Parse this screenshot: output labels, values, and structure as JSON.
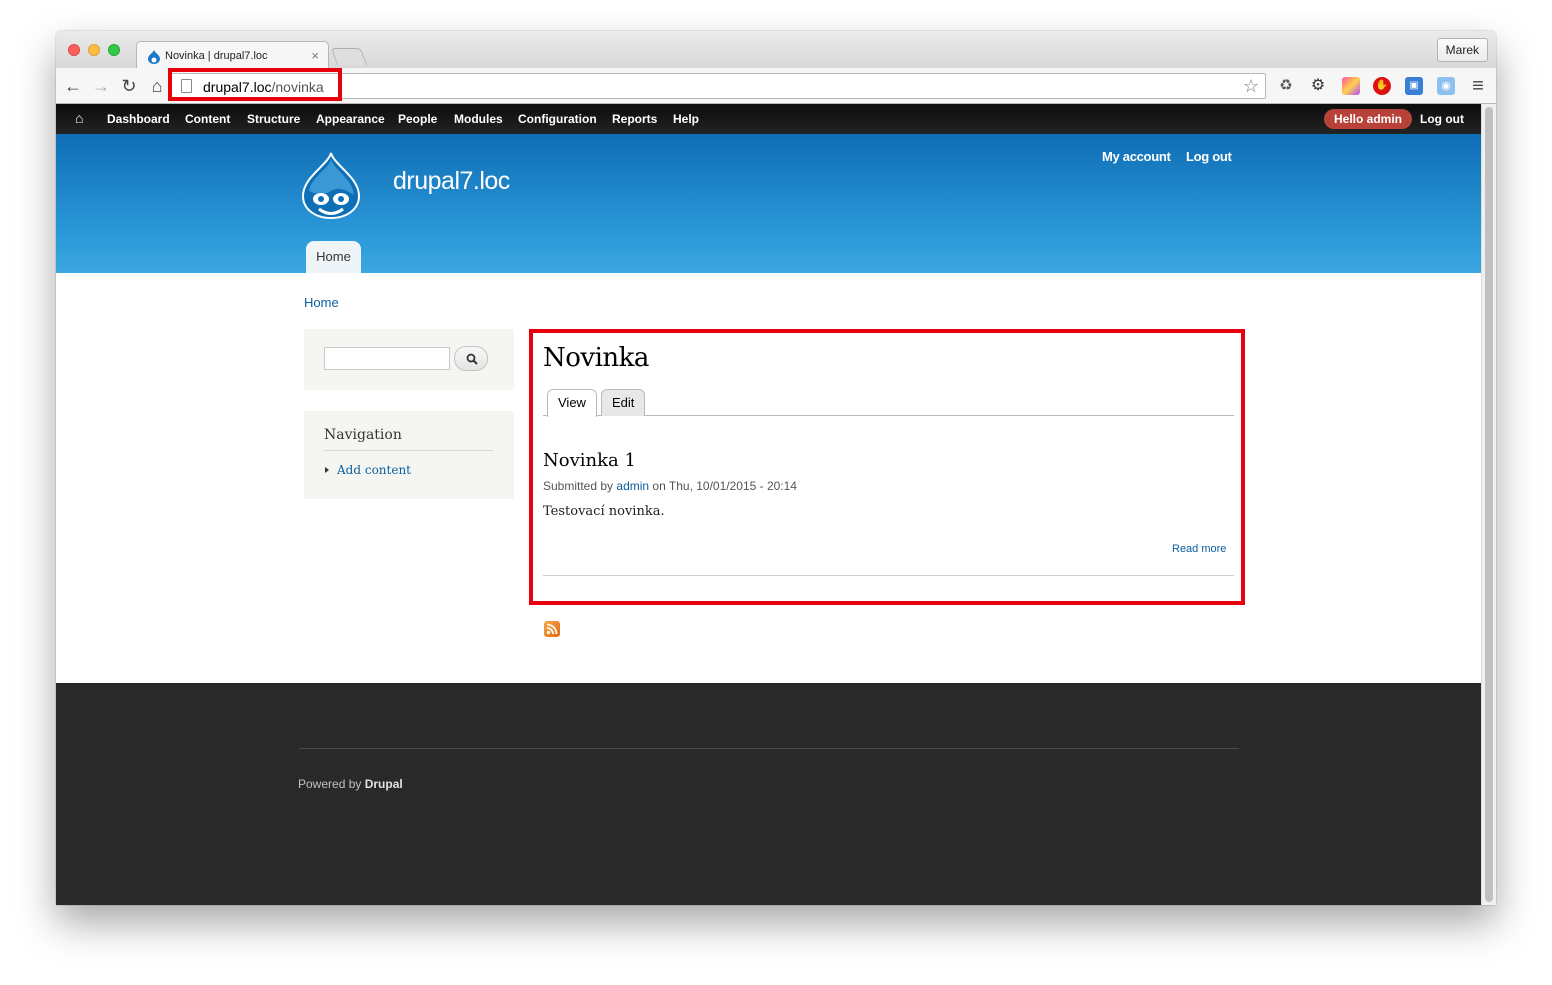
{
  "browser": {
    "tab_title": "Novinka | drupal7.loc",
    "tab_close": "×",
    "profile_name": "Marek",
    "url_host": "drupal7.loc",
    "url_path": "/novinka",
    "back_glyph": "←",
    "forward_glyph": "→",
    "reload_glyph": "↻",
    "home_glyph": "⌂",
    "star_glyph": "☆",
    "menu_glyph": "≡",
    "extensions": [
      "recycle-icon",
      "gear-icon",
      "color-picker-icon",
      "stop-icon",
      "window-icon",
      "camera-icon"
    ]
  },
  "admin_menu": {
    "home_glyph": "⌂",
    "items": [
      "Dashboard",
      "Content",
      "Structure",
      "Appearance",
      "People",
      "Modules",
      "Configuration",
      "Reports",
      "Help"
    ],
    "hello": "Hello admin",
    "logout": "Log out"
  },
  "header": {
    "site_name": "drupal7.loc",
    "secondary_menu": [
      "My account",
      "Log out"
    ],
    "main_menu": [
      "Home"
    ]
  },
  "breadcrumb": "Home",
  "sidebar": {
    "search_placeholder": "",
    "navigation_title": "Navigation",
    "navigation_items": [
      "Add content"
    ]
  },
  "content": {
    "page_title": "Novinka",
    "tabs": [
      "View",
      "Edit"
    ],
    "node": {
      "title": "Novinka 1",
      "submitted_prefix": "Submitted by",
      "author": "admin",
      "submitted_suffix": "on Thu, 10/01/2015 - 20:14",
      "body": "Testovací novinka.",
      "read_more": "Read more"
    }
  },
  "footer": {
    "powered_prefix": "Powered by",
    "powered_link": "Drupal"
  },
  "colors": {
    "header_blue": "#2a98d8",
    "highlight_red": "#e8000c",
    "link_blue": "#0b5e9e",
    "footer_bg": "#292929"
  }
}
